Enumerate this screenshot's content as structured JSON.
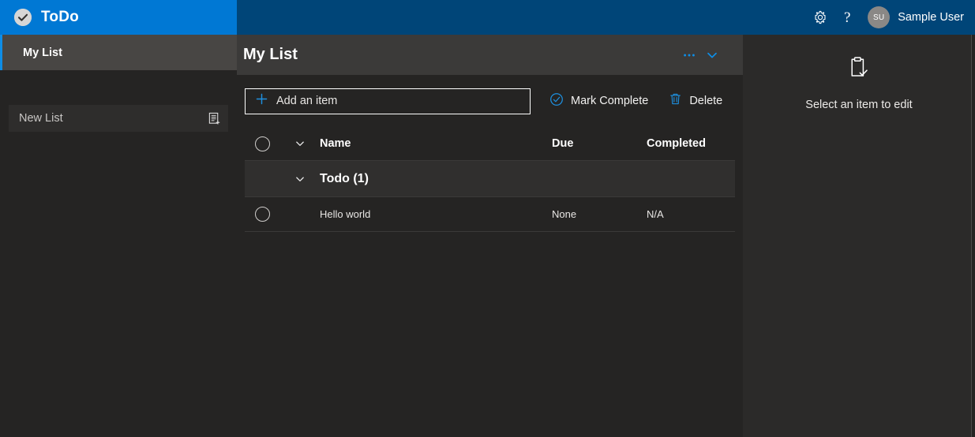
{
  "app": {
    "brand_name": "ToDo",
    "brand_icon": "check-circle-icon"
  },
  "header": {
    "settings_icon": "gear-icon",
    "help_icon": "question-mark-icon",
    "avatar_initials": "SU",
    "user_name": "Sample User",
    "brand_color": "#0078d4",
    "header_color": "#004578"
  },
  "sidebar": {
    "items": [
      {
        "label": "My List",
        "selected": true
      }
    ],
    "new_list": {
      "placeholder": "New List",
      "value": "New List",
      "icon": "add-list-icon"
    },
    "accent_color": "#0e8de6"
  },
  "main": {
    "list_title": "My List",
    "header_icons": {
      "more_icon": "ellipsis-icon",
      "collapse_icon": "chevron-down-icon"
    },
    "toolbar": {
      "add_item_label": "Add an item",
      "add_item_icon": "plus-icon",
      "mark_complete_label": "Mark Complete",
      "mark_complete_icon": "check-circle-icon",
      "delete_label": "Delete",
      "delete_icon": "trash-icon"
    },
    "table": {
      "columns": {
        "name": "Name",
        "due": "Due",
        "completed": "Completed"
      },
      "group": {
        "label": "Todo (1)",
        "expanded": true
      },
      "rows": [
        {
          "name": "Hello world",
          "due": "None",
          "completed": "N/A",
          "checked": false
        }
      ]
    }
  },
  "detail": {
    "icon": "clipboard-check-icon",
    "empty_text": "Select an item to edit"
  },
  "colors": {
    "accent": "#0078d4",
    "background": "#252423",
    "panel": "#2b2a29",
    "header_band": "#3b3a39",
    "selected_nav": "#484644"
  }
}
